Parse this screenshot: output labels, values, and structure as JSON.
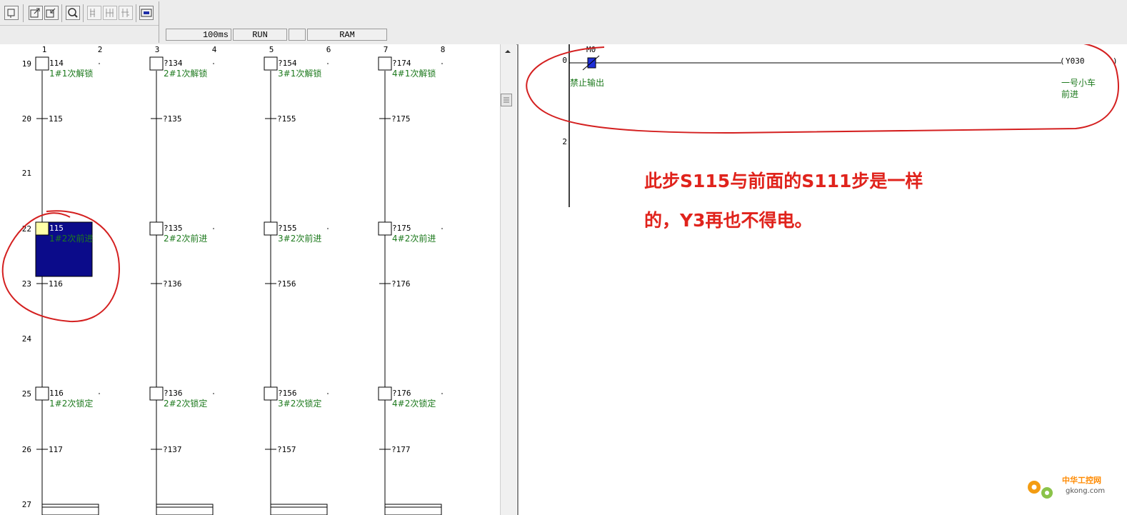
{
  "status": {
    "scan_time": "100ms",
    "mode": "RUN",
    "memory": "RAM"
  },
  "column_numbers": [
    "1",
    "2",
    "3",
    "4",
    "5",
    "6",
    "7",
    "8"
  ],
  "row_numbers": [
    "19",
    "20",
    "21",
    "22",
    "23",
    "24",
    "25",
    "26",
    "27"
  ],
  "columns": [
    {
      "steps": [
        {
          "label": "114",
          "comment": "1#1次解锁"
        },
        {
          "label": "115",
          "comment": "1#2次前进"
        },
        {
          "label": "116",
          "comment": "1#2次锁定"
        }
      ],
      "transitions": [
        "115",
        "116",
        "117"
      ]
    },
    {
      "steps": [
        {
          "label": "?134",
          "comment": "2#1次解锁"
        },
        {
          "label": "?135",
          "comment": "2#2次前进"
        },
        {
          "label": "?136",
          "comment": "2#2次锁定"
        }
      ],
      "transitions": [
        "?135",
        "?136",
        "?137"
      ]
    },
    {
      "steps": [
        {
          "label": "?154",
          "comment": "3#1次解锁"
        },
        {
          "label": "?155",
          "comment": "3#2次前进"
        },
        {
          "label": "?156",
          "comment": "3#2次锁定"
        }
      ],
      "transitions": [
        "?155",
        "?156",
        "?157"
      ]
    },
    {
      "steps": [
        {
          "label": "?174",
          "comment": "4#1次解锁"
        },
        {
          "label": "?175",
          "comment": "4#2次前进"
        },
        {
          "label": "?176",
          "comment": "4#2次锁定"
        }
      ],
      "transitions": [
        "?175",
        "?176",
        "?177"
      ]
    }
  ],
  "ladder": {
    "row_numbers": [
      "0",
      "2"
    ],
    "contact_device": "M0",
    "contact_comment": "禁止输出",
    "coil_device": "Y030",
    "coil_comment_line1": "一号小车",
    "coil_comment_line2": "前进"
  },
  "annotation": {
    "line1": "此步S115与前面的S111步是一样",
    "line2": "的，Y3再也不得电。"
  },
  "watermark": {
    "cn": "中华工控网",
    "en": "gkong.com"
  },
  "colors": {
    "selection": "#0b0b8a",
    "comment": "#1e7a1e",
    "annotation": "#e0231c",
    "circle": "#d42020"
  }
}
